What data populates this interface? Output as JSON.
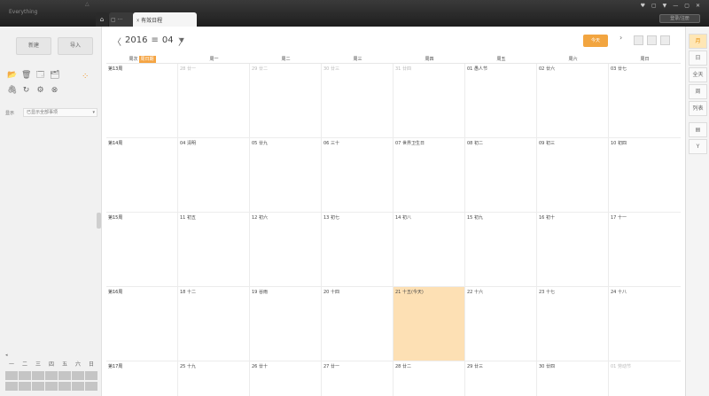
{
  "window": {
    "app_name": "Everything",
    "top_mark": "△",
    "tab_home_icon": "⌂",
    "tab_doc_label": "▢ ···",
    "tab_active_label": "☓ 有效日程",
    "controls": [
      "♥",
      "▢",
      "▼",
      "—",
      "▢",
      "✕"
    ],
    "user_button": "登录/注册"
  },
  "sidebar": {
    "new_button": "新建",
    "import_button": "导入",
    "tool_icons": [
      "📂",
      "🗑",
      "🗔",
      "🗂",
      "🖇",
      "↻",
      "⚙",
      "⊗"
    ],
    "more_icon": "⁘",
    "filter_label": "显示",
    "filter_value": "已显示全部事项",
    "filter_arrow": "▾",
    "mini_toggle": "◂",
    "mini_weekdays": [
      "一",
      "二",
      "三",
      "四",
      "五",
      "六",
      "日"
    ]
  },
  "calendar": {
    "prev": "〈",
    "year": "2016",
    "month": "04",
    "month_sep": "≡",
    "month_caret": "▾",
    "next": "〉",
    "today_button": "今天",
    "head_arrow": "›",
    "weekday_first": "周次",
    "weekday_highlight": "周日期",
    "weekdays": [
      "周一",
      "周二",
      "周三",
      "周四",
      "周五",
      "周六",
      "周日"
    ],
    "rows": [
      [
        "第13周",
        "28 廿一",
        "29 廿二",
        "30 廿三",
        "31 廿四",
        "01 愚人节",
        "02 廿六",
        "03 廿七"
      ],
      [
        "第14周",
        "04 清明",
        "05 廿九",
        "06 三十",
        "07 世界卫生日",
        "08 初二",
        "09 初三",
        "10 初四"
      ],
      [
        "第15周",
        "11 初五",
        "12 初六",
        "13 初七",
        "14 初八",
        "15 初九",
        "16 初十",
        "17 十一"
      ],
      [
        "第16周",
        "18 十二",
        "19 谷雨",
        "20 十四",
        "21 十五(今天)",
        "22 十六",
        "23 十七",
        "24 十八"
      ],
      [
        "第17周",
        "25 十九",
        "26 廿十",
        "27 廿一",
        "28 廿二",
        "29 廿三",
        "30 廿四",
        "01 劳动节"
      ]
    ]
  },
  "rightbar": {
    "items": [
      "月",
      "日",
      "全天",
      "周",
      "列表"
    ],
    "extra_icons": [
      "▤",
      "Y"
    ]
  }
}
